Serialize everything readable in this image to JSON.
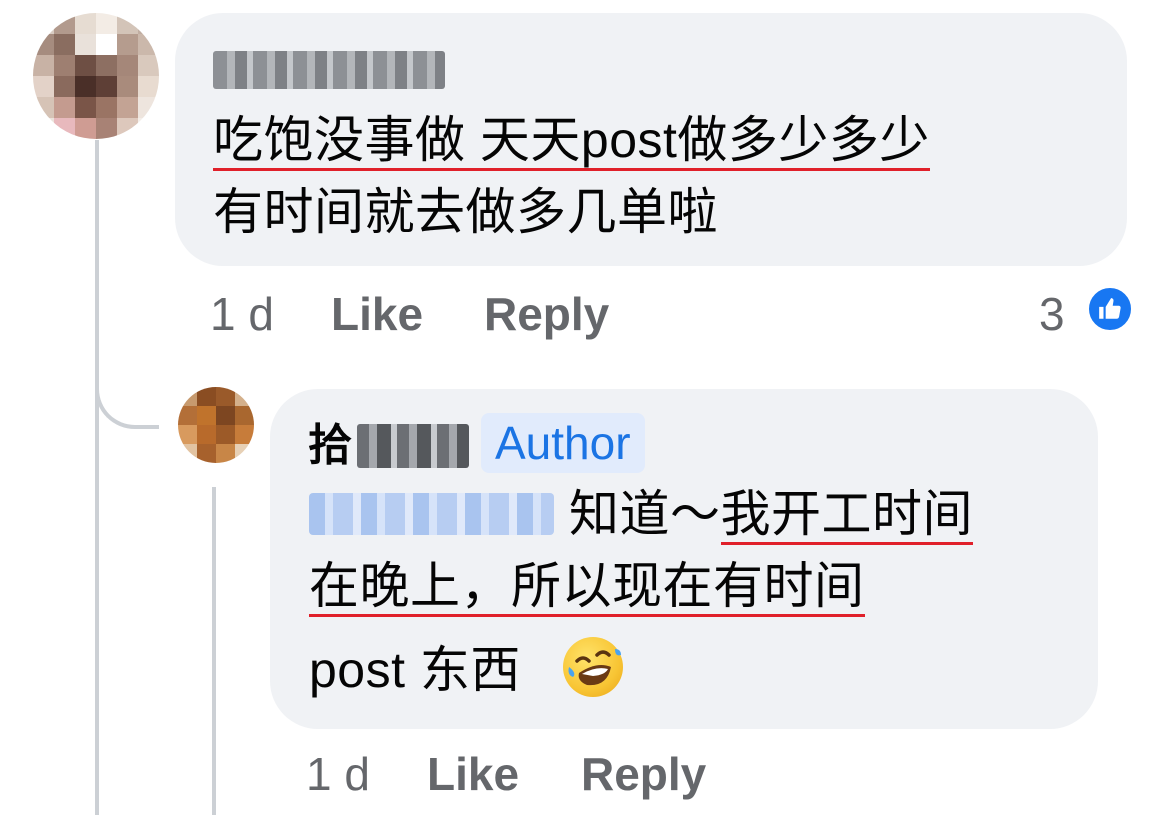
{
  "comment1": {
    "line1_underlined": "吃饱没事做 天天post做多少多少",
    "line2": "有时间就去做多几单啦",
    "time": "1 d",
    "like_label": "Like",
    "reply_label": "Reply",
    "reaction_count": "3"
  },
  "reply1": {
    "author_first_char": "拾",
    "author_badge": "Author",
    "line1_plain": "知道～",
    "line1_underlined": "我开工时间",
    "line2_underlined": "在晚上，所以现在有时间",
    "line3": "post 东西",
    "emoji_icon": "rolling-on-floor-laughing-emoji",
    "time": "1 d",
    "like_label": "Like",
    "reply_label": "Reply"
  },
  "colors": {
    "bubble": "#f0f2f5",
    "meta_text": "#65676b",
    "underline": "#e0202a",
    "brand_blue": "#1877f2",
    "badge_bg": "#e1ebfc",
    "badge_text": "#1b74e4"
  }
}
